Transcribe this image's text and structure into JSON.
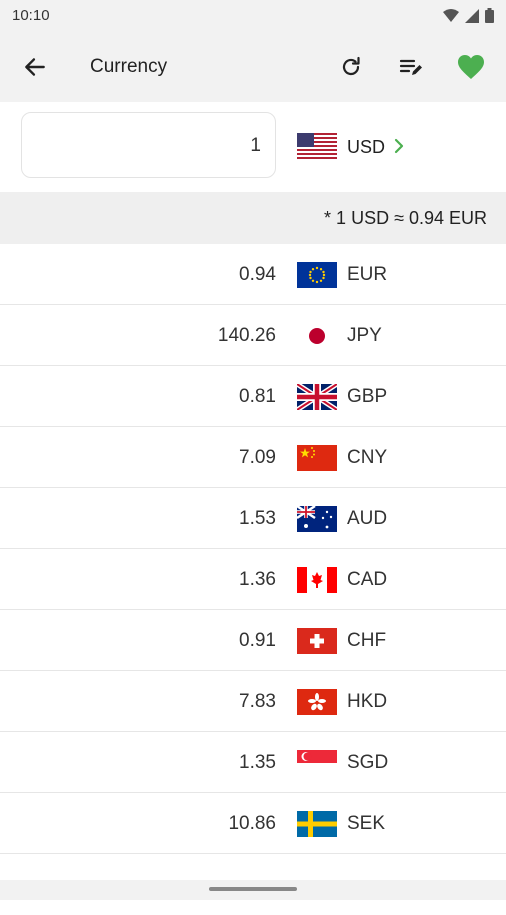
{
  "status": {
    "time": "10:10"
  },
  "appbar": {
    "title": "Currency"
  },
  "base": {
    "amount": "1",
    "code": "USD"
  },
  "rate_note": "* 1 USD ≈ 0.94 EUR",
  "rows": [
    {
      "value": "0.94",
      "code": "EUR"
    },
    {
      "value": "140.26",
      "code": "JPY"
    },
    {
      "value": "0.81",
      "code": "GBP"
    },
    {
      "value": "7.09",
      "code": "CNY"
    },
    {
      "value": "1.53",
      "code": "AUD"
    },
    {
      "value": "1.36",
      "code": "CAD"
    },
    {
      "value": "0.91",
      "code": "CHF"
    },
    {
      "value": "7.83",
      "code": "HKD"
    },
    {
      "value": "1.35",
      "code": "SGD"
    },
    {
      "value": "10.86",
      "code": "SEK"
    }
  ],
  "colors": {
    "accent": "#4caf50",
    "heart": "#4caf50"
  }
}
